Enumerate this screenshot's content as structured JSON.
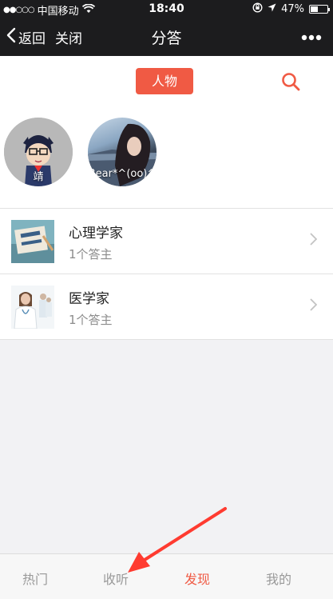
{
  "status_bar": {
    "signal": "●●○○○",
    "carrier": "中国移动",
    "time": "18:40",
    "battery": "47%",
    "battery_level": 0.47
  },
  "nav": {
    "back_label": "返回",
    "close_label": "关闭",
    "title": "分答"
  },
  "filter": {
    "active_tab": "人物",
    "accent_color": "#f05a44"
  },
  "people": [
    {
      "name": "靖"
    },
    {
      "name": "Bear*^(oo)^"
    }
  ],
  "categories": [
    {
      "title": "心理学家",
      "subtitle": "1个答主"
    },
    {
      "title": "医学家",
      "subtitle": "1个答主"
    }
  ],
  "tabs": [
    {
      "label": "热门",
      "active": false
    },
    {
      "label": "收听",
      "active": false
    },
    {
      "label": "发现",
      "active": true
    },
    {
      "label": "我的",
      "active": false
    }
  ]
}
